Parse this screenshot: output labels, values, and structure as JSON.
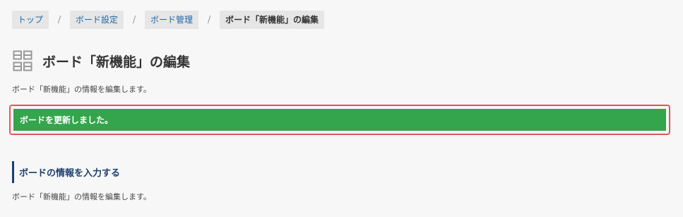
{
  "breadcrumb": {
    "items": [
      {
        "label": "トップ"
      },
      {
        "label": "ボード設定"
      },
      {
        "label": "ボード管理"
      },
      {
        "label": "ボード「新機能」の編集"
      }
    ],
    "separator": "/"
  },
  "header": {
    "icon": "board-grid-icon",
    "title": "ボード「新機能」の編集"
  },
  "description_top": "ボード「新機能」の情報を編集します。",
  "alert": {
    "message": "ボードを更新しました。",
    "color": "#34a54c",
    "outline_color": "#e35656"
  },
  "section": {
    "heading": "ボードの情報を入力する",
    "description": "ボード「新機能」の情報を編集します。",
    "accent_color": "#1b3f6e"
  }
}
